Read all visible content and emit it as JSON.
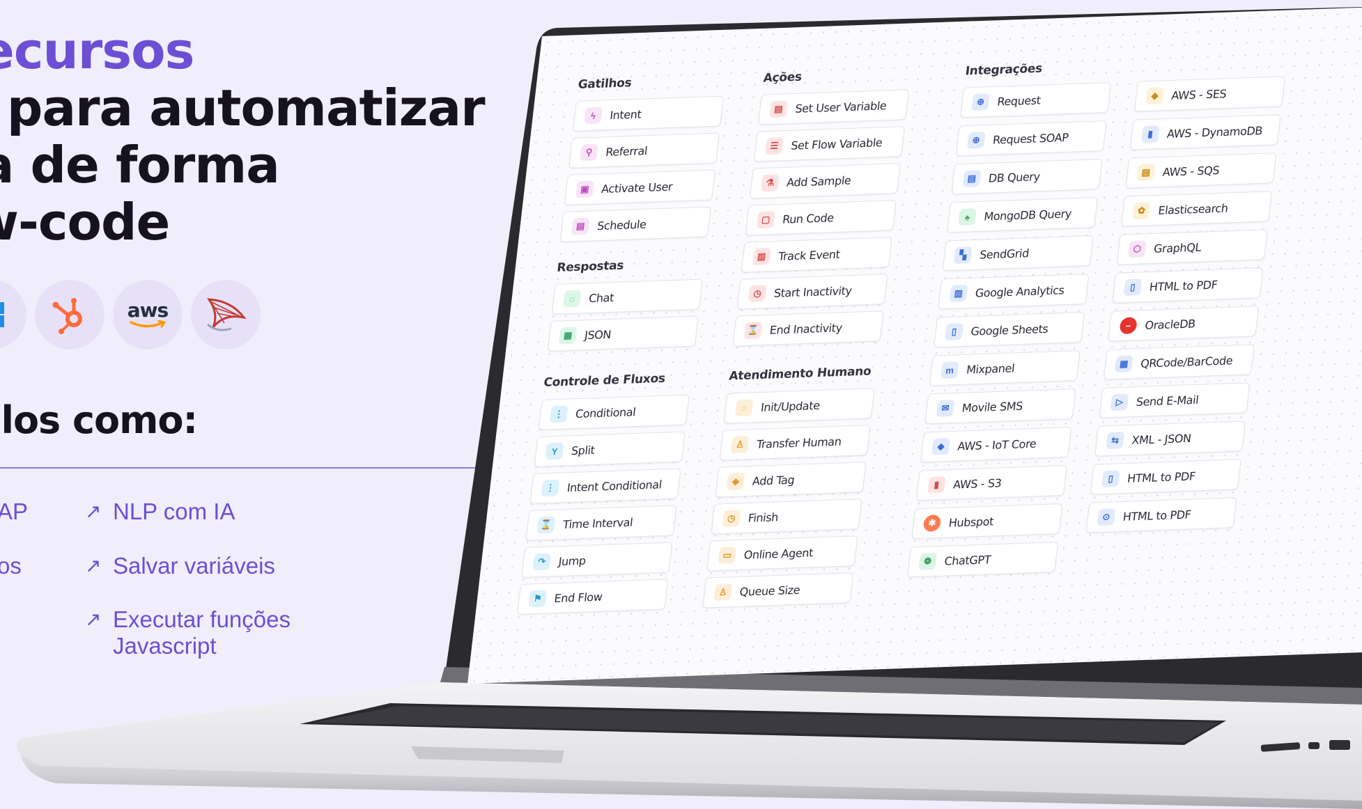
{
  "hero": {
    "line1": "ecursos",
    "line2": "s para automatizar",
    "line3": "sa de forma",
    "line4": "ow-code",
    "subheading": "ulos como:",
    "accent_color": "#6c4fd4",
    "features": {
      "col1_a": "AP",
      "col1_b": "os",
      "f1": "NLP com IA",
      "f2": "Salvar variáveis",
      "f3_line1": "Executar funções",
      "f3_line2": "Javascript"
    },
    "logos": [
      "windows-logo",
      "hubspot-logo",
      "aws-logo",
      "sqlserver-logo"
    ],
    "aws_text": "aws"
  },
  "screen": {
    "sections": {
      "gatilhos": "Gatilhos",
      "respostas": "Respostas",
      "controle": "Controle de Fluxos",
      "acoes": "Ações",
      "atendimento": "Atendimento Humano",
      "integracoes": "Integrações"
    },
    "gatilhos": [
      "Intent",
      "Referral",
      "Activate User",
      "Schedule"
    ],
    "respostas": [
      "Chat",
      "JSON"
    ],
    "controle": [
      "Conditional",
      "Split",
      "Intent Conditional",
      "Time Interval",
      "Jump",
      "End Flow"
    ],
    "acoes": [
      "Set User Variable",
      "Set Flow Variable",
      "Add Sample",
      "Run Code",
      "Track Event",
      "Start Inactivity",
      "End Inactivity"
    ],
    "atendimento": [
      "Init/Update",
      "Transfer Human",
      "Add Tag",
      "Finish",
      "Online Agent",
      "Queue Size"
    ],
    "integracoes_col1": [
      "Request",
      "Request SOAP",
      "DB Query",
      "MongoDB Query",
      "SendGrid",
      "Google Analytics",
      "Google Sheets",
      "Mixpanel",
      "Movile SMS",
      "AWS - IoT Core",
      "AWS - S3",
      "Hubspot",
      "ChatGPT"
    ],
    "integracoes_col2": [
      "AWS - SES",
      "AWS - DynamoDB",
      "AWS - SQS",
      "Elasticsearch",
      "GraphQL",
      "HTML to PDF",
      "OracleDB",
      "QRCode/BarCode",
      "Send E-Mail",
      "XML - JSON",
      "HTML to PDF",
      "HTML to PDF"
    ]
  }
}
